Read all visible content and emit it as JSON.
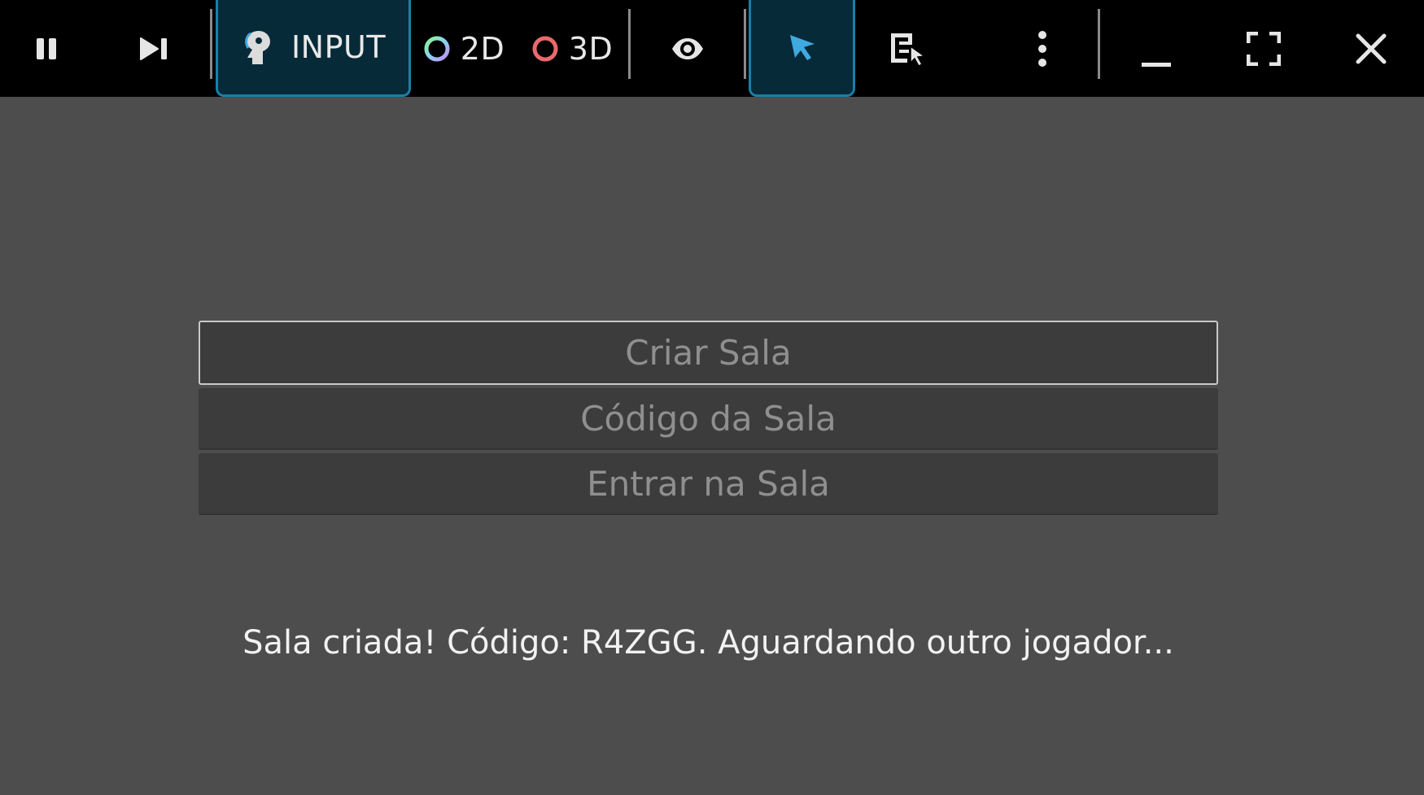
{
  "toolbar": {
    "input_label": "INPUT",
    "mode_2d_label": "2D",
    "mode_3d_label": "3D",
    "icons": {
      "pause": "pause-icon",
      "step": "step-forward-icon",
      "input": "input-wrench-icon",
      "mode_2d": "ring-2d-icon",
      "mode_3d": "ring-3d-icon",
      "visibility": "eye-icon",
      "select": "pointer-icon",
      "list_select": "list-pointer-icon",
      "more": "more-vertical-icon",
      "minimize": "minimize-icon",
      "maximize": "fullscreen-icon",
      "close": "close-icon"
    },
    "colors": {
      "active_bg": "#062a38",
      "active_border": "#1b7fa6",
      "select_icon": "#3fa9e0",
      "ring_3d": "#e86a6a"
    }
  },
  "menu": {
    "create_room": "Criar Sala",
    "room_code_placeholder": "Código da Sala",
    "join_room": "Entrar na Sala",
    "status": "Sala criada! Código: R4ZGG. Aguardando outro jogador..."
  }
}
